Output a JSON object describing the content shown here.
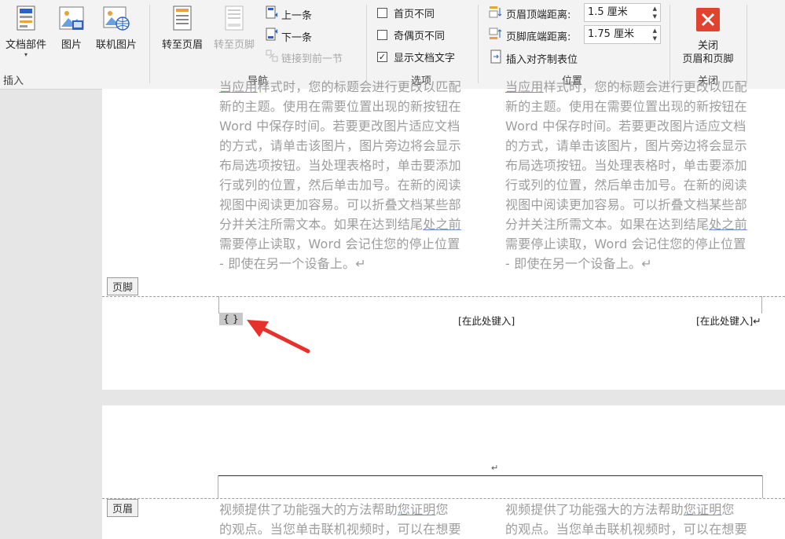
{
  "ribbon": {
    "insert_group": {
      "doc_parts": "文档部件",
      "picture": "图片",
      "online_picture": "联机图片",
      "title": "插入"
    },
    "nav_group": {
      "goto_header": "转至页眉",
      "goto_footer": "转至页脚",
      "previous": "上一条",
      "next": "下一条",
      "link_previous": "链接到前一节",
      "title": "导航"
    },
    "options_group": {
      "diff_first": "首页不同",
      "diff_odd_even": "奇偶页不同",
      "show_doc_text": "显示文档文字",
      "diff_first_checked": false,
      "diff_odd_even_checked": false,
      "show_doc_text_checked": true,
      "title": "选项"
    },
    "position_group": {
      "header_top_label": "页眉顶端距离:",
      "header_top_value": "1.5 厘米",
      "footer_bottom_label": "页脚底端距离:",
      "footer_bottom_value": "1.75 厘米",
      "insert_align_tab": "插入对齐制表位",
      "title": "位置"
    },
    "close_group": {
      "close_line1": "关闭",
      "close_line2": "页眉和页脚",
      "title": "关闭"
    }
  },
  "doc": {
    "page1_col1": {
      "l0a": "当应用",
      "l0b": "样式时，您的标题会进行更改以匹配",
      "l1": "新的主题。使用在需要位置出现的新按钮在",
      "l2": "Word 中保存时间。若要更改图片适应文档",
      "l3": "的方式，请单击该图片，图片旁边将会显示",
      "l4": "布局选项按钮。当处理表格时，单击要添加",
      "l5": "行或列的位置，然后单击加号。在新的阅读",
      "l6": "视图中阅读更加容易。可以折叠文档某些部",
      "l7a": "分并关注所需文本。如果在达到结尾",
      "l7b": "处之前",
      "l8": "需要停止读取，Word 会记住您的停止位置",
      "l9": "- 即使在另一个设备上。↵"
    },
    "page1_col2": {
      "l0a": "当应用",
      "l0b": "样式时，您的标题会进行更改以匹配",
      "l1": "新的主题。使用在需要位置出现的新按钮在",
      "l2": "Word 中保存时间。若要更改图片适应文档",
      "l3": "的方式，请单击该图片，图片旁边将会显示",
      "l4": "布局选项按钮。当处理表格时，单击要添加",
      "l5": "行或列的位置，然后单击加号。在新的阅读",
      "l6": "视图中阅读更加容易。可以折叠文档某些部",
      "l7a": "分并关注所需文本。如果在达到结尾",
      "l7b": "处之前",
      "l8": "需要停止读取，Word 会记住您的停止位置",
      "l9": "- 即使在另一个设备上。↵"
    },
    "footer_tag": "页脚",
    "footer_field": "{ }",
    "footer_placeholder_center": "[在此处键入]",
    "footer_placeholder_right": "[在此处键入]↵",
    "header_tag": "页眉",
    "header_mark": "↵",
    "page2_col1": {
      "l0a": "视频提供了功能强大的方法帮助",
      "l0b": "您证明",
      "l0c": "您",
      "l1": "的观点。当您单击联机视频时，可以在想要"
    },
    "page2_col2": {
      "l0a": "视频提供了功能强大的方法帮助",
      "l0b": "您证明",
      "l0c": "您",
      "l1": "的观点。当您单击联机视频时，可以在想要"
    }
  },
  "colors": {
    "close_red": "#e0432f",
    "arrow_red": "#e8312a",
    "accent_blue": "#2b63c6"
  }
}
